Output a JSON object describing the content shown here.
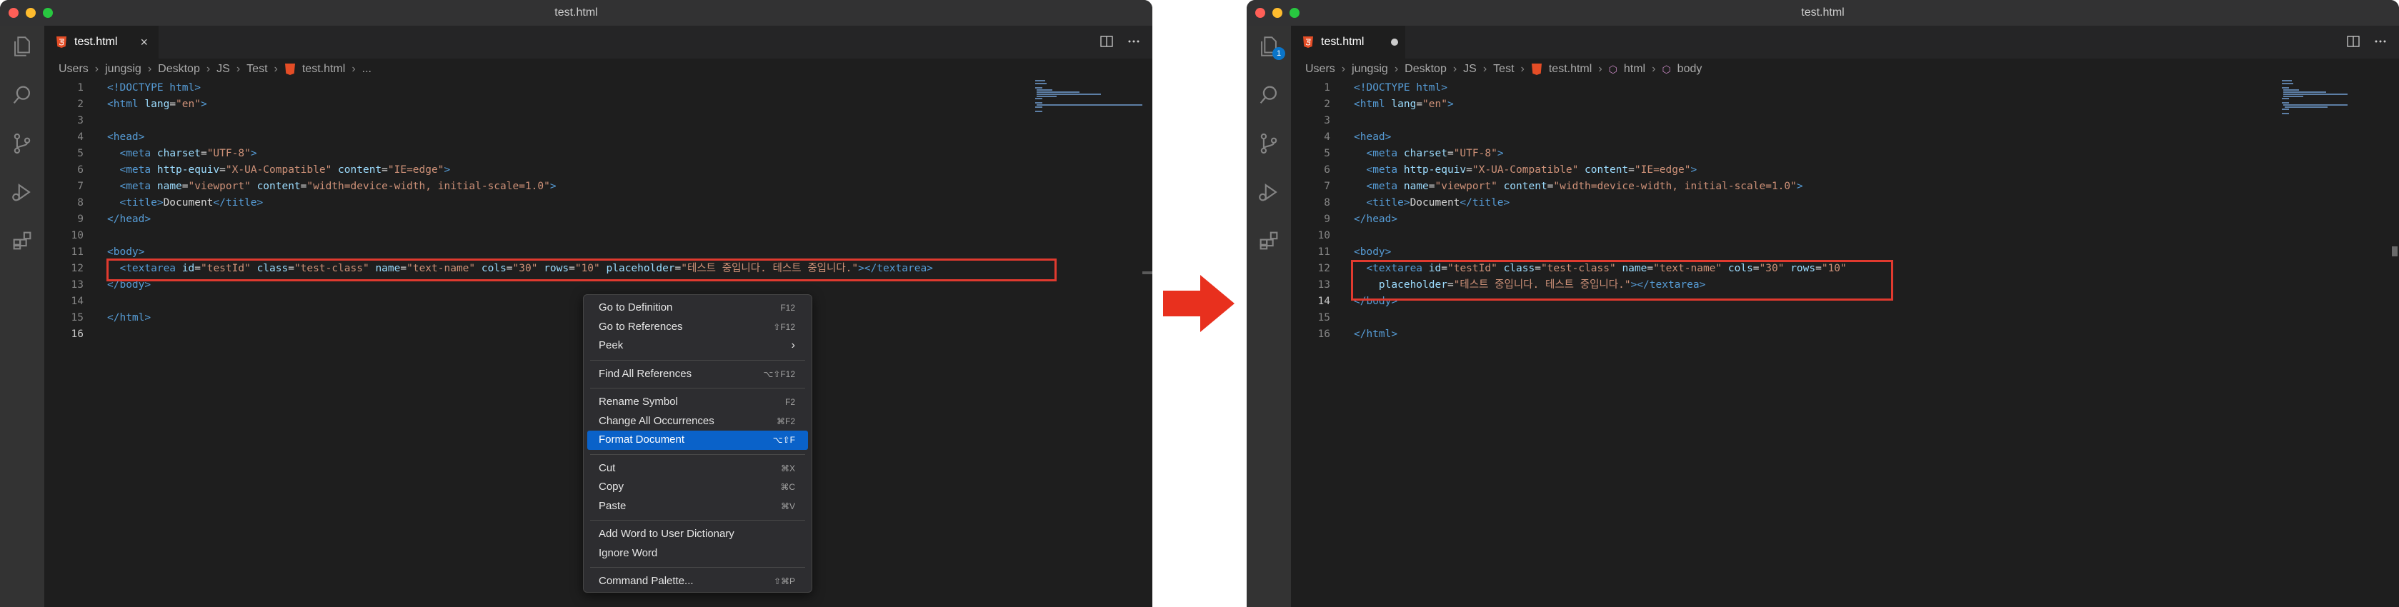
{
  "left_window": {
    "title": "test.html",
    "tab": {
      "label": "test.html",
      "close": "×"
    },
    "breadcrumb": [
      "Users",
      "jungsig",
      "Desktop",
      "JS",
      "Test",
      "test.html",
      "..."
    ],
    "context_menu": {
      "groups": [
        [
          {
            "label": "Go to Definition",
            "shortcut": "F12"
          },
          {
            "label": "Go to References",
            "shortcut": "⇧F12"
          },
          {
            "label": "Peek",
            "shortcut": "›"
          }
        ],
        [
          {
            "label": "Find All References",
            "shortcut": "⌥⇧F12"
          }
        ],
        [
          {
            "label": "Rename Symbol",
            "shortcut": "F2"
          },
          {
            "label": "Change All Occurrences",
            "shortcut": "⌘F2"
          },
          {
            "label": "Format Document",
            "shortcut": "⌥⇧F",
            "selected": true
          }
        ],
        [
          {
            "label": "Cut",
            "shortcut": "⌘X"
          },
          {
            "label": "Copy",
            "shortcut": "⌘C"
          },
          {
            "label": "Paste",
            "shortcut": "⌘V"
          }
        ],
        [
          {
            "label": "Add Word to User Dictionary",
            "shortcut": ""
          },
          {
            "label": "Ignore Word",
            "shortcut": ""
          }
        ],
        [
          {
            "label": "Command Palette...",
            "shortcut": "⇧⌘P"
          }
        ]
      ]
    },
    "code_lines": [
      {
        "n": "1",
        "t": [
          [
            "tag",
            "<!DOCTYPE html>"
          ]
        ]
      },
      {
        "n": "2",
        "t": [
          [
            "tag",
            "<html "
          ],
          [
            "attr",
            "lang"
          ],
          [
            "txt",
            "="
          ],
          [
            "str",
            "\"en\""
          ],
          [
            "tag",
            ">"
          ]
        ]
      },
      {
        "n": "3",
        "t": []
      },
      {
        "n": "4",
        "t": [
          [
            "tag",
            "<head>"
          ]
        ]
      },
      {
        "n": "5",
        "t": [
          [
            "txt",
            "  "
          ],
          [
            "tag",
            "<meta "
          ],
          [
            "attr",
            "charset"
          ],
          [
            "txt",
            "="
          ],
          [
            "str",
            "\"UTF-8\""
          ],
          [
            "tag",
            ">"
          ]
        ]
      },
      {
        "n": "6",
        "t": [
          [
            "txt",
            "  "
          ],
          [
            "tag",
            "<meta "
          ],
          [
            "attr",
            "http-equiv"
          ],
          [
            "txt",
            "="
          ],
          [
            "str",
            "\"X-UA-Compatible\""
          ],
          [
            "txt",
            " "
          ],
          [
            "attr",
            "content"
          ],
          [
            "txt",
            "="
          ],
          [
            "str",
            "\"IE=edge\""
          ],
          [
            "tag",
            ">"
          ]
        ]
      },
      {
        "n": "7",
        "t": [
          [
            "txt",
            "  "
          ],
          [
            "tag",
            "<meta "
          ],
          [
            "attr",
            "name"
          ],
          [
            "txt",
            "="
          ],
          [
            "str",
            "\"viewport\""
          ],
          [
            "txt",
            " "
          ],
          [
            "attr",
            "content"
          ],
          [
            "txt",
            "="
          ],
          [
            "str",
            "\"width=device-width, initial-scale=1.0\""
          ],
          [
            "tag",
            ">"
          ]
        ]
      },
      {
        "n": "8",
        "t": [
          [
            "txt",
            "  "
          ],
          [
            "tag",
            "<title>"
          ],
          [
            "txt",
            "Document"
          ],
          [
            "tag",
            "</title>"
          ]
        ]
      },
      {
        "n": "9",
        "t": [
          [
            "tag",
            "</head>"
          ]
        ]
      },
      {
        "n": "10",
        "t": []
      },
      {
        "n": "11",
        "t": [
          [
            "tag",
            "<body>"
          ]
        ]
      },
      {
        "n": "12",
        "t": [
          [
            "txt",
            "  "
          ],
          [
            "tag",
            "<textarea "
          ],
          [
            "attr",
            "id"
          ],
          [
            "txt",
            "="
          ],
          [
            "str",
            "\"testId\""
          ],
          [
            "txt",
            " "
          ],
          [
            "attr",
            "class"
          ],
          [
            "txt",
            "="
          ],
          [
            "str",
            "\"test-class\""
          ],
          [
            "txt",
            " "
          ],
          [
            "attr",
            "name"
          ],
          [
            "txt",
            "="
          ],
          [
            "str",
            "\"text-name\""
          ],
          [
            "txt",
            " "
          ],
          [
            "attr",
            "cols"
          ],
          [
            "txt",
            "="
          ],
          [
            "str",
            "\"30\""
          ],
          [
            "txt",
            " "
          ],
          [
            "attr",
            "rows"
          ],
          [
            "txt",
            "="
          ],
          [
            "str",
            "\"10\""
          ],
          [
            "txt",
            " "
          ],
          [
            "attr",
            "placeholder"
          ],
          [
            "txt",
            "="
          ],
          [
            "str",
            "\"테스트 중입니다. 테스트 중입니다.\""
          ],
          [
            "tag",
            "></textarea>"
          ]
        ]
      },
      {
        "n": "13",
        "t": [
          [
            "tag",
            "</body>"
          ]
        ]
      },
      {
        "n": "14",
        "t": []
      },
      {
        "n": "15",
        "t": [
          [
            "tag",
            "</html>"
          ]
        ]
      },
      {
        "n": "16",
        "t": []
      }
    ],
    "active_line": "16"
  },
  "right_window": {
    "title": "test.html",
    "tab": {
      "label": "test.html"
    },
    "badge": "1",
    "breadcrumb": [
      "Users",
      "jungsig",
      "Desktop",
      "JS",
      "Test",
      "test.html",
      "html",
      "body"
    ],
    "code_lines": [
      {
        "n": "1",
        "t": [
          [
            "tag",
            "<!DOCTYPE html>"
          ]
        ]
      },
      {
        "n": "2",
        "t": [
          [
            "tag",
            "<html "
          ],
          [
            "attr",
            "lang"
          ],
          [
            "txt",
            "="
          ],
          [
            "str",
            "\"en\""
          ],
          [
            "tag",
            ">"
          ]
        ]
      },
      {
        "n": "3",
        "t": []
      },
      {
        "n": "4",
        "t": [
          [
            "tag",
            "<head>"
          ]
        ]
      },
      {
        "n": "5",
        "t": [
          [
            "txt",
            "  "
          ],
          [
            "tag",
            "<meta "
          ],
          [
            "attr",
            "charset"
          ],
          [
            "txt",
            "="
          ],
          [
            "str",
            "\"UTF-8\""
          ],
          [
            "tag",
            ">"
          ]
        ]
      },
      {
        "n": "6",
        "t": [
          [
            "txt",
            "  "
          ],
          [
            "tag",
            "<meta "
          ],
          [
            "attr",
            "http-equiv"
          ],
          [
            "txt",
            "="
          ],
          [
            "str",
            "\"X-UA-Compatible\""
          ],
          [
            "txt",
            " "
          ],
          [
            "attr",
            "content"
          ],
          [
            "txt",
            "="
          ],
          [
            "str",
            "\"IE=edge\""
          ],
          [
            "tag",
            ">"
          ]
        ]
      },
      {
        "n": "7",
        "t": [
          [
            "txt",
            "  "
          ],
          [
            "tag",
            "<meta "
          ],
          [
            "attr",
            "name"
          ],
          [
            "txt",
            "="
          ],
          [
            "str",
            "\"viewport\""
          ],
          [
            "txt",
            " "
          ],
          [
            "attr",
            "content"
          ],
          [
            "txt",
            "="
          ],
          [
            "str",
            "\"width=device-width, initial-scale=1.0\""
          ],
          [
            "tag",
            ">"
          ]
        ]
      },
      {
        "n": "8",
        "t": [
          [
            "txt",
            "  "
          ],
          [
            "tag",
            "<title>"
          ],
          [
            "txt",
            "Document"
          ],
          [
            "tag",
            "</title>"
          ]
        ]
      },
      {
        "n": "9",
        "t": [
          [
            "tag",
            "</head>"
          ]
        ]
      },
      {
        "n": "10",
        "t": []
      },
      {
        "n": "11",
        "t": [
          [
            "tag",
            "<body>"
          ]
        ]
      },
      {
        "n": "12",
        "t": [
          [
            "txt",
            "  "
          ],
          [
            "tag",
            "<textarea "
          ],
          [
            "attr",
            "id"
          ],
          [
            "txt",
            "="
          ],
          [
            "str",
            "\"testId\""
          ],
          [
            "txt",
            " "
          ],
          [
            "attr",
            "class"
          ],
          [
            "txt",
            "="
          ],
          [
            "str",
            "\"test-class\""
          ],
          [
            "txt",
            " "
          ],
          [
            "attr",
            "name"
          ],
          [
            "txt",
            "="
          ],
          [
            "str",
            "\"text-name\""
          ],
          [
            "txt",
            " "
          ],
          [
            "attr",
            "cols"
          ],
          [
            "txt",
            "="
          ],
          [
            "str",
            "\"30\""
          ],
          [
            "txt",
            " "
          ],
          [
            "attr",
            "rows"
          ],
          [
            "txt",
            "="
          ],
          [
            "str",
            "\"10\""
          ]
        ]
      },
      {
        "n": "13",
        "t": [
          [
            "txt",
            "    "
          ],
          [
            "attr",
            "placeholder"
          ],
          [
            "txt",
            "="
          ],
          [
            "str",
            "\"테스트 중입니다. 테스트 중입니다.\""
          ],
          [
            "tag",
            "></textarea>"
          ]
        ]
      },
      {
        "n": "14",
        "t": [
          [
            "tag",
            "</body>"
          ]
        ]
      },
      {
        "n": "15",
        "t": []
      },
      {
        "n": "16",
        "t": [
          [
            "tag",
            "</html>"
          ]
        ]
      }
    ],
    "active_line": "14"
  },
  "colors": {
    "highlight_box": "#e03a2f",
    "arrow": "#e8301e",
    "menu_selection": "#0a62c9"
  },
  "icons": [
    "files-icon",
    "search-icon",
    "source-control-icon",
    "run-debug-icon",
    "extensions-icon",
    "split-editor-icon",
    "more-actions-icon",
    "html-file-icon"
  ]
}
